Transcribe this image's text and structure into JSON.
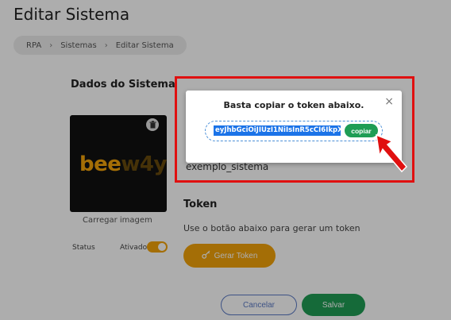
{
  "page": {
    "title": "Editar Sistema"
  },
  "breadcrumb": [
    "RPA",
    "Sistemas",
    "Editar Sistema"
  ],
  "form": {
    "section_title": "Dados do Sistema",
    "logo_text_main": "bee",
    "logo_text_dim": "w4y",
    "upload_label": "Carregar imagem",
    "status_label": "Status",
    "status_value": "Ativado",
    "system_name": "exemplo_sistema",
    "token_title": "Token",
    "token_hint": "Use o botão abaixo para gerar um token",
    "generate_label": "Gerar Token",
    "cancel_label": "Cancelar",
    "save_label": "Salvar"
  },
  "modal": {
    "title": "Basta copiar o token abaixo.",
    "token_value": "eyJhbGciOiJIUzI1NiIsInR5cCI6IkpX",
    "copy_label": "copiar",
    "close_glyph": "×"
  },
  "colors": {
    "accent_orange": "#f2a20a",
    "success_green": "#1f9d55",
    "highlight_red": "#e01010",
    "token_blue": "#1b73e8"
  }
}
